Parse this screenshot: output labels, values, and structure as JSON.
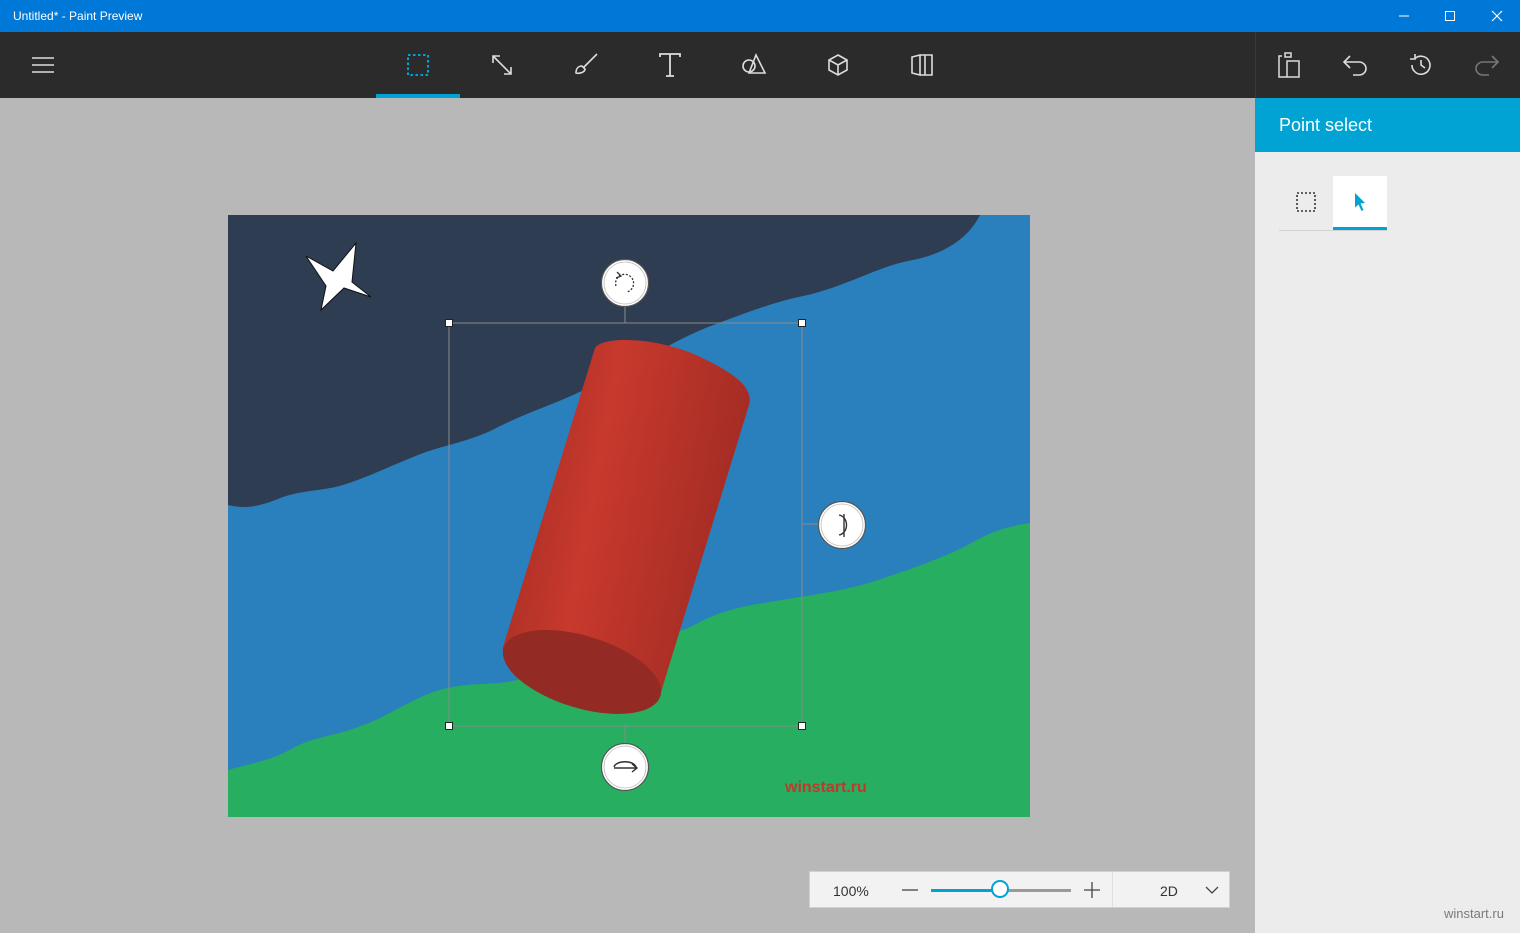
{
  "window": {
    "title": "Untitled* - Paint Preview"
  },
  "toolbar": {
    "menu_icon": "hamburger-menu-icon",
    "tools": [
      {
        "name": "select",
        "icon": "select-rectangle-icon",
        "active": true
      },
      {
        "name": "crop",
        "icon": "crop-resize-icon",
        "active": false
      },
      {
        "name": "brushes",
        "icon": "brush-icon",
        "active": false
      },
      {
        "name": "text",
        "icon": "text-icon",
        "active": false
      },
      {
        "name": "2d-shapes",
        "icon": "shapes-icon",
        "active": false
      },
      {
        "name": "3d-objects",
        "icon": "cube-icon",
        "active": false
      },
      {
        "name": "stickers",
        "icon": "sticker-book-icon",
        "active": false
      }
    ],
    "right_icons": [
      "paste-icon",
      "undo-icon",
      "history-icon",
      "redo-icon"
    ]
  },
  "panel": {
    "title": "Point select",
    "modes": [
      {
        "name": "rectangle-select",
        "icon": "dashed-rectangle-icon",
        "active": false
      },
      {
        "name": "point-select",
        "icon": "cursor-arrow-icon",
        "active": true
      }
    ]
  },
  "canvas": {
    "watermark_text": "winstart.ru",
    "colors": {
      "sky": "#2e3d52",
      "water": "#2980bd",
      "grass": "#27ae60",
      "cylinder": "#c0392b",
      "star": "#ffffff",
      "watermark": "#c0392b"
    }
  },
  "zoom": {
    "percent_label": "100%",
    "slider_fraction": 0.5,
    "view_mode": "2D"
  },
  "footer": {
    "watermark": "winstart.ru"
  },
  "accent_color": "#00a3d4",
  "titlebar_color": "#0078d7"
}
